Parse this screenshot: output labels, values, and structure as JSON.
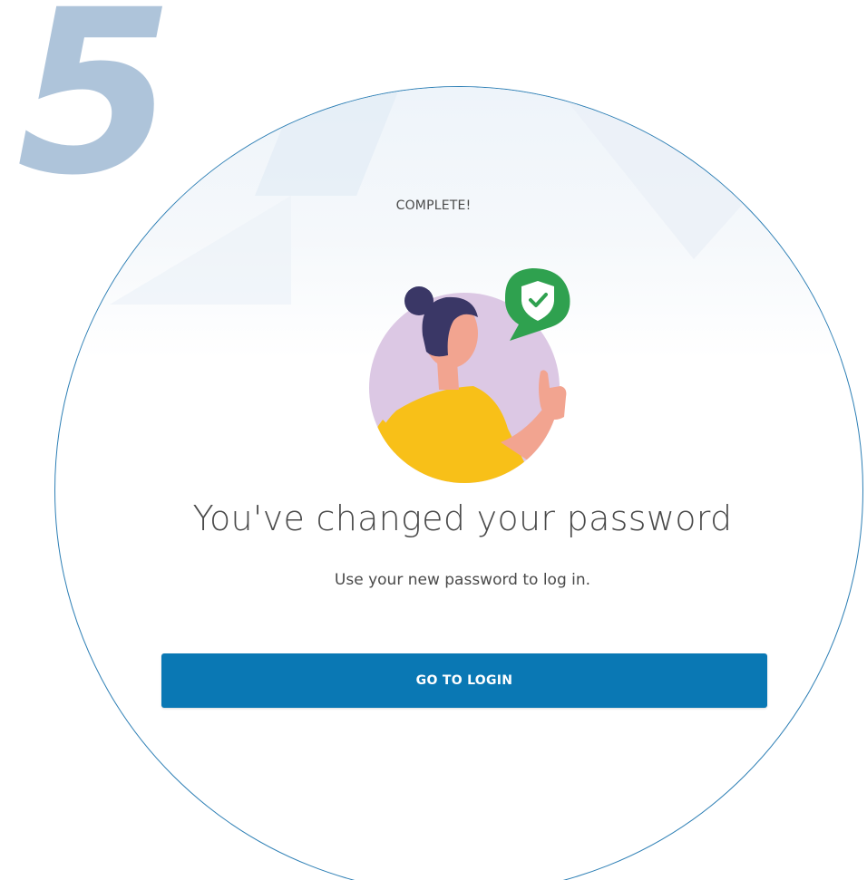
{
  "step": {
    "number": "5"
  },
  "page": {
    "status_label": "COMPLETE!",
    "headline": "You've changed your password",
    "subtext": "Use your new password to log in.",
    "login_button_label": "GO TO LOGIN"
  },
  "illustration": {
    "icon": "woman-thumbs-up-shield-check-icon"
  },
  "colors": {
    "accent": "#0a78b4",
    "step_number": "#aec4da",
    "frame_border": "#2d7fb5",
    "shield_badge": "#2fa14f",
    "illustration_bg": "#dcc8e4",
    "shirt": "#f8c018",
    "skin": "#f2a490",
    "hair": "#3a3766"
  }
}
